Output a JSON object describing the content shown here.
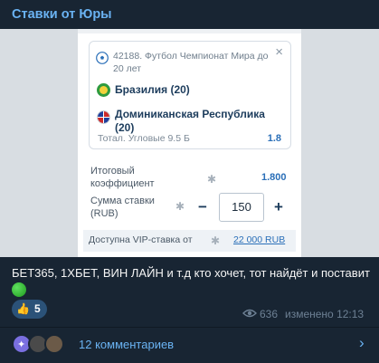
{
  "channel": {
    "name": "Ставки от Юры"
  },
  "bet_slip": {
    "event_title": "42188. Футбол Чемпионат Мира до 20 лет",
    "team1": "Бразилия (20)",
    "team2": "Доминиканская Республика (20)",
    "market": "Тотал. Угловые 9.5 Б",
    "market_odds": "1.8",
    "total_coef_label": "Итоговый коэффициент",
    "total_coef_value": "1.800",
    "stake_label": "Сумма ставки (RUB)",
    "stake_minus": "−",
    "stake_value": "150",
    "stake_plus": "+",
    "vip_label": "Доступна VIP-ставка от",
    "vip_amount": "22 000 RUB",
    "close_symbol": "×",
    "gear_symbol": "✱"
  },
  "message": {
    "caption": "БЕТ365, 1ХБЕТ, ВИН ЛАЙН и т.д кто хочет, тот найдёт и поставит",
    "reaction_emoji": "👍",
    "reaction_count": "5",
    "views": "636",
    "edited": "изменено 12:13"
  },
  "comments": {
    "label": "12 комментариев",
    "chevron": "›"
  },
  "colors": {
    "background": "#182533",
    "accent": "#6ab3f3",
    "odds_blue": "#2a6fb8",
    "reaction_bg": "#2b5278"
  },
  "icons": [
    "soccer-ball-icon",
    "close-icon",
    "brazil-flag-icon",
    "dominican-flag-icon",
    "gear-icon",
    "green-circle-icon",
    "eye-icon",
    "chevron-right-icon"
  ]
}
